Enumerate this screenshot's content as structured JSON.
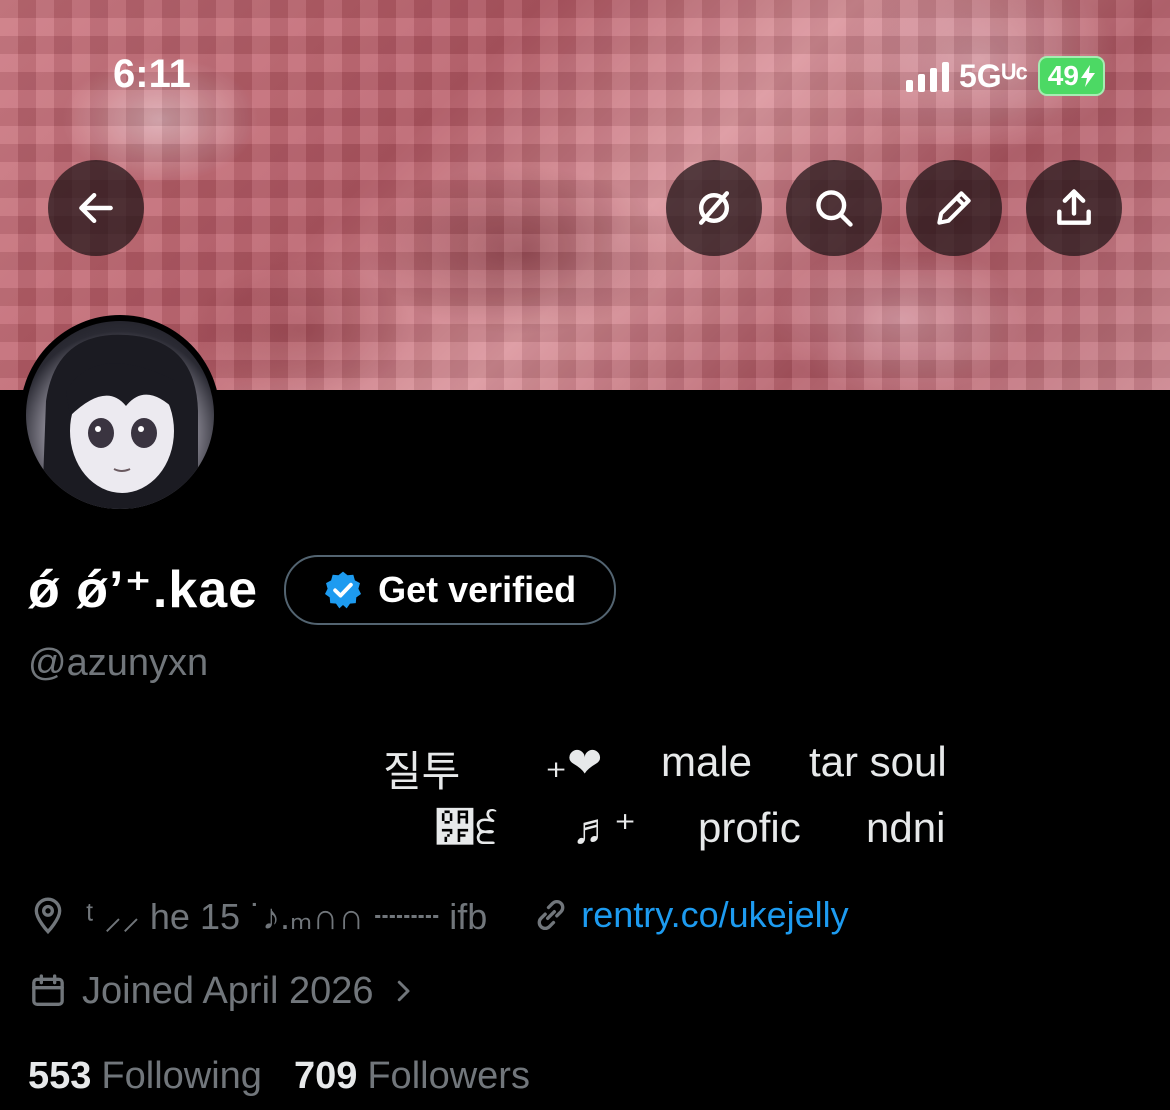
{
  "status_bar": {
    "time": "6:11",
    "network": "5Gᵁᶜ",
    "battery": "49"
  },
  "header_actions": {
    "back_icon": "arrow-left-icon",
    "hide_icon": "eye-slash-icon",
    "search_icon": "search-icon",
    "edit_icon": "pencil-icon",
    "share_icon": "share-icon"
  },
  "profile": {
    "display_name": "ǿ ǿʼ⁺.kae",
    "verify_label": "Get verified",
    "handle": "@azunyxn",
    "bio_line1": [
      "질투",
      "₊❤",
      "male",
      "tar soul"
    ],
    "bio_line2": [
      "੿੬",
      "♬⁺",
      "profic",
      "ndni"
    ],
    "location_text": "ᵗ ⸝⸝ he   15    ˙♪.ₘ∩∩ ┄┄┄  ifb",
    "link": "rentry.co/ukejelly",
    "joined": "Joined April 2026",
    "following_count": "553",
    "following_label": "Following",
    "followers_count": "709",
    "followers_label": "Followers"
  },
  "colors": {
    "accent": "#1d9bf0",
    "muted": "#71767b",
    "background": "#000000",
    "verified_badge": "#1d9bf0"
  }
}
